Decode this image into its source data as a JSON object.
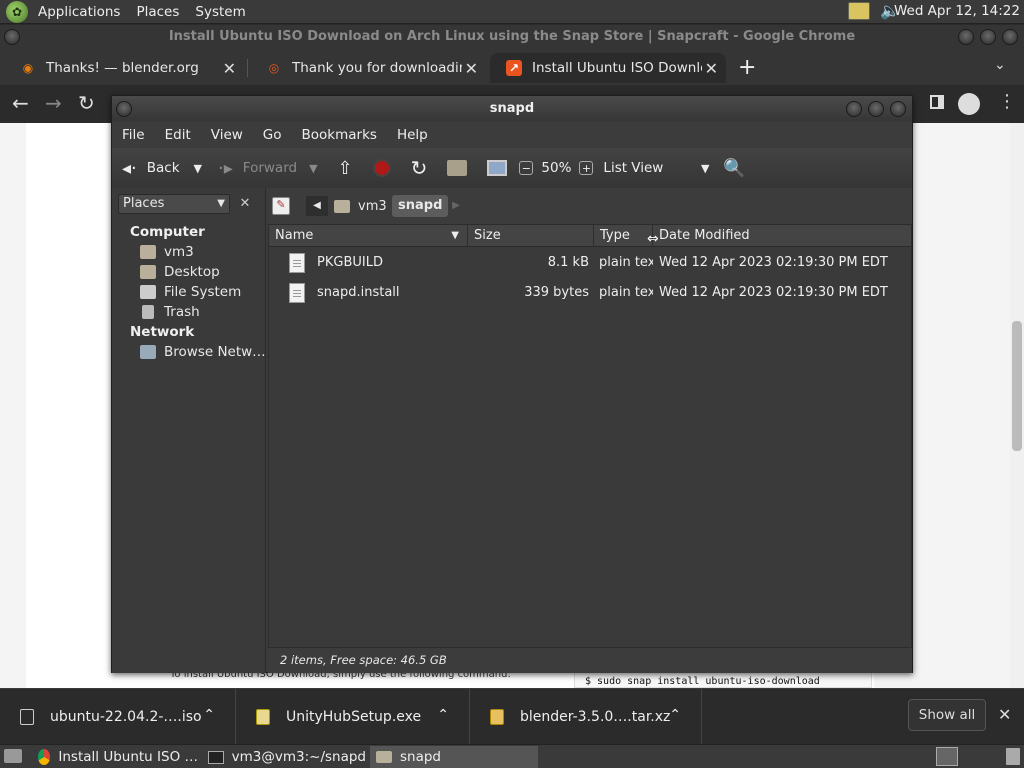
{
  "top_panel": {
    "menus": [
      "Applications",
      "Places",
      "System"
    ],
    "clock": "Wed Apr 12, 14:22"
  },
  "chrome": {
    "window_title": "Install Ubuntu ISO Download on Arch Linux using the Snap Store | Snapcraft - Google Chrome",
    "tabs": [
      {
        "label": "Thanks! — blender.org",
        "favicon_color": "#e87d0d"
      },
      {
        "label": "Thank you for downloading Ub",
        "favicon_color": "#e95420"
      },
      {
        "label": "Install Ubuntu ISO Download",
        "favicon_color": "#e95420"
      }
    ],
    "page_text_left": "To install Ubuntu ISO Download, simply use the following command:",
    "page_code": "$ sudo snap install ubuntu-iso-download"
  },
  "nautilus": {
    "title": "snapd",
    "menus": [
      "File",
      "Edit",
      "View",
      "Go",
      "Bookmarks",
      "Help"
    ],
    "toolbar": {
      "back": "Back",
      "forward": "Forward",
      "zoom": "50%",
      "view_mode": "List View"
    },
    "sidebar": {
      "combo": "Places",
      "sections": [
        {
          "heading": "Computer",
          "items": [
            "vm3",
            "Desktop",
            "File System",
            "Trash"
          ]
        },
        {
          "heading": "Network",
          "items": [
            "Browse Netw…"
          ]
        }
      ]
    },
    "path": [
      "vm3",
      "snapd"
    ],
    "columns": [
      "Name",
      "Size",
      "Type",
      "Date Modified"
    ],
    "files": [
      {
        "name": "PKGBUILD",
        "size": "8.1 kB",
        "type": "plain text",
        "modified": "Wed 12 Apr 2023 02:19:30 PM EDT"
      },
      {
        "name": "snapd.install",
        "size": "339 bytes",
        "type": "plain text",
        "modified": "Wed 12 Apr 2023 02:19:30 PM EDT"
      }
    ],
    "status": "2 items, Free space: 46.5 GB"
  },
  "downloads": [
    {
      "name": "ubuntu-22.04.2-….iso"
    },
    {
      "name": "UnityHubSetup.exe"
    },
    {
      "name": "blender-3.5.0….tar.xz"
    }
  ],
  "downloads_show_all": "Show all",
  "taskbar": [
    {
      "label": "Install Ubuntu ISO …"
    },
    {
      "label": "vm3@vm3:~/snapd"
    },
    {
      "label": "snapd"
    }
  ]
}
